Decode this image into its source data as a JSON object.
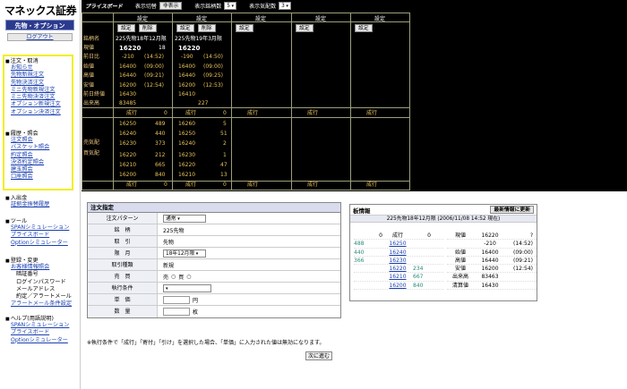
{
  "logo": "マネックス証券",
  "product": "先物・オプション",
  "logout": "ログアウト",
  "sidebar": {
    "s1": {
      "h": "注文・取消",
      "items": [
        "お知らせ",
        "先物新規注文",
        "先物決済注文",
        "ミニ先物新規注文",
        "ミニ先物決済注文",
        "オプション新規注文",
        "オプション決済注文"
      ]
    },
    "s2": {
      "h": "履歴・照会",
      "items": [
        "注文照会",
        "バスケット照会",
        "約定照会",
        "決済約定照会",
        "建玉照会",
        "口座照会"
      ]
    },
    "s3": {
      "h": "入出金",
      "items": [
        "証拠金振替履歴"
      ]
    },
    "s4": {
      "h": "ツール",
      "items": [
        "SPANシミュレーション",
        "プライスボード",
        "Optionシミュレーター"
      ]
    },
    "s5": {
      "h": "登録・変更",
      "items": [
        "お客様情報照会"
      ],
      "plain": [
        "暗証番号",
        "ログインパスワード",
        "メールアドレス",
        "約定／アラートメール"
      ],
      "last": "アラートメール条件設定"
    },
    "s6": {
      "h": "ヘルプ(用語説明)",
      "items": [
        "SPANシミュレーション",
        "プライスボード",
        "Optionシミュレーター"
      ]
    }
  },
  "board": {
    "title": "プライスボード",
    "switch_label": "表示切替",
    "switch_btn": "非表示",
    "count_label": "表示銘柄数",
    "count_val": "5",
    "cols_label": "表示気配数",
    "cols_val": "3",
    "setting": "設定",
    "delete": "削除",
    "labels": [
      "銘柄名",
      "現値",
      "前日比",
      "始値",
      "高値",
      "安値",
      "前日終値",
      "出来高"
    ],
    "c1": {
      "name": "225先物18年12月限",
      "cur": "16220",
      "cur2": "18",
      "chg": "-210",
      "chgt": "(14:52)",
      "open": "16400",
      "opent": "(09:00)",
      "high": "16440",
      "hight": "(09:21)",
      "low": "16200",
      "lowt": "(12:54)",
      "prev": "16430",
      "vol": "83485"
    },
    "c2": {
      "name": "225先物19年3月限",
      "cur": "16220",
      "chg": "-190",
      "chgt": "(14:50)",
      "open": "16400",
      "opent": "(09:00)",
      "high": "16440",
      "hight": "(09:25)",
      "low": "16200",
      "lowt": "(12:53)",
      "prev": "16410",
      "vol": "227"
    },
    "market": "成行",
    "sell_label": "売気配",
    "buy_label": "買気配",
    "c1_sell": [
      [
        "16250",
        "489"
      ],
      [
        "16240",
        "440"
      ],
      [
        "16230",
        "373"
      ]
    ],
    "c1_buy": [
      [
        "16220",
        "212"
      ],
      [
        "16210",
        "665"
      ],
      [
        "16200",
        "840"
      ]
    ],
    "c1_mkt_top": "0",
    "c1_mkt_bot": "0",
    "c2_sell": [
      [
        "16260",
        "5"
      ],
      [
        "16250",
        "51"
      ],
      [
        "16240",
        "2"
      ]
    ],
    "c2_buy": [
      [
        "16230",
        "1"
      ],
      [
        "16220",
        "47"
      ],
      [
        "16210",
        "13"
      ]
    ],
    "c2_mkt_top": "0",
    "c2_mkt_bot": "0"
  },
  "order": {
    "title": "注文指定",
    "rows": [
      {
        "k": "注文パターン",
        "v": "通常"
      },
      {
        "k": "銘　柄",
        "v": "225先物"
      },
      {
        "k": "取　引",
        "v": "先物"
      },
      {
        "k": "限　月",
        "v": "18年12月限"
      },
      {
        "k": "取引種類",
        "v": "新規"
      },
      {
        "k": "売　買",
        "v": "売",
        "v2": "買"
      },
      {
        "k": "執行条件",
        "v": ""
      },
      {
        "k": "単　価",
        "v": "円"
      },
      {
        "k": "数　量",
        "v": "枚"
      }
    ],
    "note": "※執行条件で「成行」「寄付」「引け」を選択した場合、「単価」に入力された値は無効になります。",
    "next": "次に進む"
  },
  "info": {
    "title": "板情報",
    "refresh": "最新情報に更新",
    "sub": "225先物18年12月限 (2006/11/08 14:52 現在)",
    "left": [
      [
        "",
        "0",
        "成行",
        "0"
      ],
      [
        "488",
        "",
        "16250",
        ""
      ],
      [
        "440",
        "",
        "16240",
        ""
      ],
      [
        "366",
        "",
        "16230",
        ""
      ],
      [
        "",
        "",
        "16220",
        "234"
      ],
      [
        "",
        "",
        "16210",
        "667"
      ],
      [
        "",
        "",
        "16200",
        "840"
      ]
    ],
    "right": [
      [
        "現値",
        "16220",
        "?"
      ],
      [
        "",
        "-210",
        "(14:52)"
      ],
      [
        "始値",
        "16400",
        "(09:00)"
      ],
      [
        "高値",
        "16440",
        "(09:21)"
      ],
      [
        "安値",
        "16200",
        "(12:54)"
      ],
      [
        "出来高",
        "83463",
        ""
      ],
      [
        "清算値",
        "16430",
        ""
      ]
    ]
  }
}
